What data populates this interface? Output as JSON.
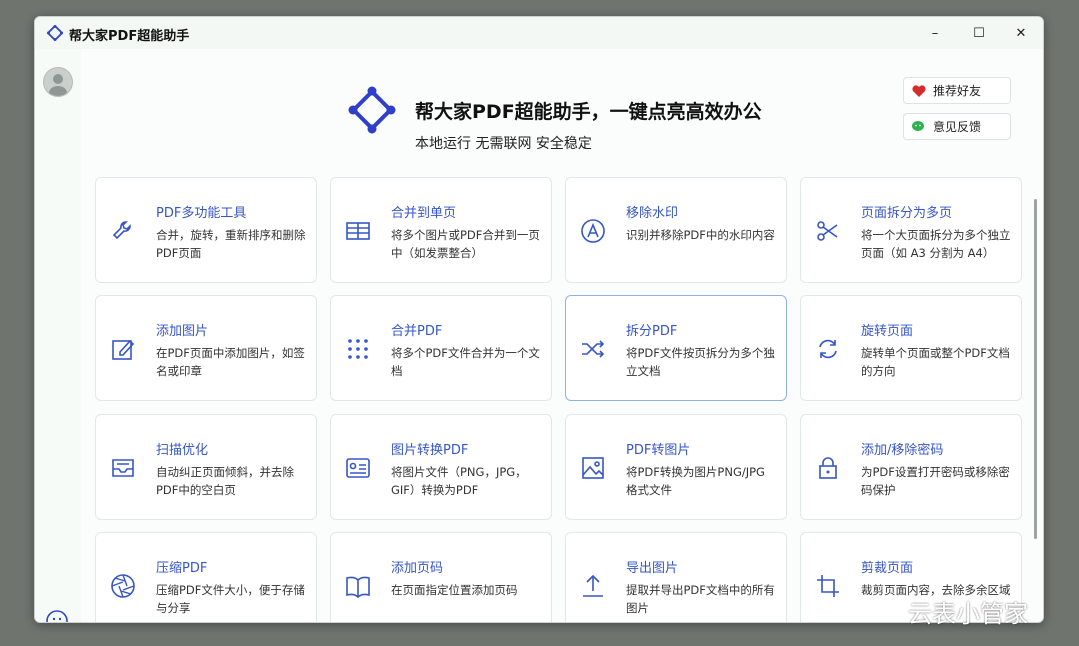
{
  "window": {
    "title": "帮大家PDF超能助手"
  },
  "controls": {
    "minimize": "–",
    "maximize": "☐",
    "close": "✕"
  },
  "hero": {
    "title": "帮大家PDF超能助手，一键点亮高效办公",
    "subtitle": "本地运行 无需联网 安全稳定"
  },
  "actions": {
    "recommend": "推荐好友",
    "feedback": "意见反馈"
  },
  "tools": [
    {
      "title": "PDF多功能工具",
      "desc": "合并，旋转，重新排序和删除PDF页面",
      "icon": "wrench-icon"
    },
    {
      "title": "合并到单页",
      "desc": "将多个图片或PDF合并到一页中（如发票整合）",
      "icon": "table-icon"
    },
    {
      "title": "移除水印",
      "desc": "识别并移除PDF中的水印内容",
      "icon": "watermark-icon"
    },
    {
      "title": "页面拆分为多页",
      "desc": "将一个大页面拆分为多个独立页面（如 A3 分割为 A4）",
      "icon": "scissors-icon"
    },
    {
      "title": "添加图片",
      "desc": "在PDF页面中添加图片，如签名或印章",
      "icon": "edit-icon"
    },
    {
      "title": "合并PDF",
      "desc": "将多个PDF文件合并为一个文档",
      "icon": "dots-grid-icon"
    },
    {
      "title": "拆分PDF",
      "desc": "将PDF文件按页拆分为多个独立文档",
      "icon": "shuffle-icon"
    },
    {
      "title": "旋转页面",
      "desc": "旋转单个页面或整个PDF文档的方向",
      "icon": "rotate-icon"
    },
    {
      "title": "扫描优化",
      "desc": "自动纠正页面倾斜，并去除PDF中的空白页",
      "icon": "inbox-icon"
    },
    {
      "title": "图片转换PDF",
      "desc": "将图片文件（PNG，JPG，GIF）转换为PDF",
      "icon": "id-card-icon"
    },
    {
      "title": "PDF转图片",
      "desc": "将PDF转换为图片PNG/JPG格式文件",
      "icon": "image-icon"
    },
    {
      "title": "添加/移除密码",
      "desc": "为PDF设置打开密码或移除密码保护",
      "icon": "lock-icon"
    },
    {
      "title": "压缩PDF",
      "desc": "压缩PDF文件大小，便于存储与分享",
      "icon": "aperture-icon"
    },
    {
      "title": "添加页码",
      "desc": "在页面指定位置添加页码",
      "icon": "book-icon"
    },
    {
      "title": "导出图片",
      "desc": "提取并导出PDF文档中的所有图片",
      "icon": "upload-icon"
    },
    {
      "title": "剪裁页面",
      "desc": "裁剪页面内容，去除多余区域",
      "icon": "crop-icon"
    }
  ],
  "watermark": "云表小管家",
  "colors": {
    "accent": "#3656c7",
    "background": "#fbfdfc"
  }
}
